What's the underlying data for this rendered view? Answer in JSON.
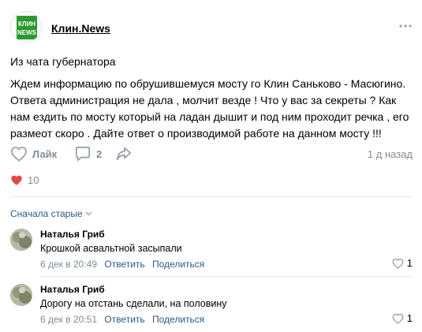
{
  "post": {
    "author": "Клин.News",
    "logo_text": "КЛИН NEWS",
    "title": "Из чата губернатора",
    "text": "Ждем информацию по обрушившемуся мосту го Клин Саньково - Масюгино. Ответа администрация не дала , молчит везде ! Что у вас за секреты ? Как нам ездить по мосту который на ладан дышит и под ним проходит речка , его размеот скоро . Дайте ответ о производимой работе на данном мосту !!!",
    "like_label": "Лайк",
    "comments_count": "2",
    "time": "1 д назад",
    "reactions_count": "10",
    "colors": {
      "accent": "#2a5885",
      "muted": "#818c99",
      "like_heart": "#e64646",
      "logo_green": "#2b9a2f"
    }
  },
  "comments": {
    "sort_label": "Сначала старые",
    "items": [
      {
        "author": "Наталья Гриб",
        "text": "Крошкой асвальтной засыпали",
        "date": "6 дек в 20:49",
        "reply_label": "Ответить",
        "share_label": "Поделиться",
        "likes": "1"
      },
      {
        "author": "Наталья Гриб",
        "text": "Дорогу на отстань сделали, на половину",
        "date": "6 дек в 20:51",
        "reply_label": "Ответить",
        "share_label": "Поделиться",
        "likes": "1"
      }
    ]
  }
}
